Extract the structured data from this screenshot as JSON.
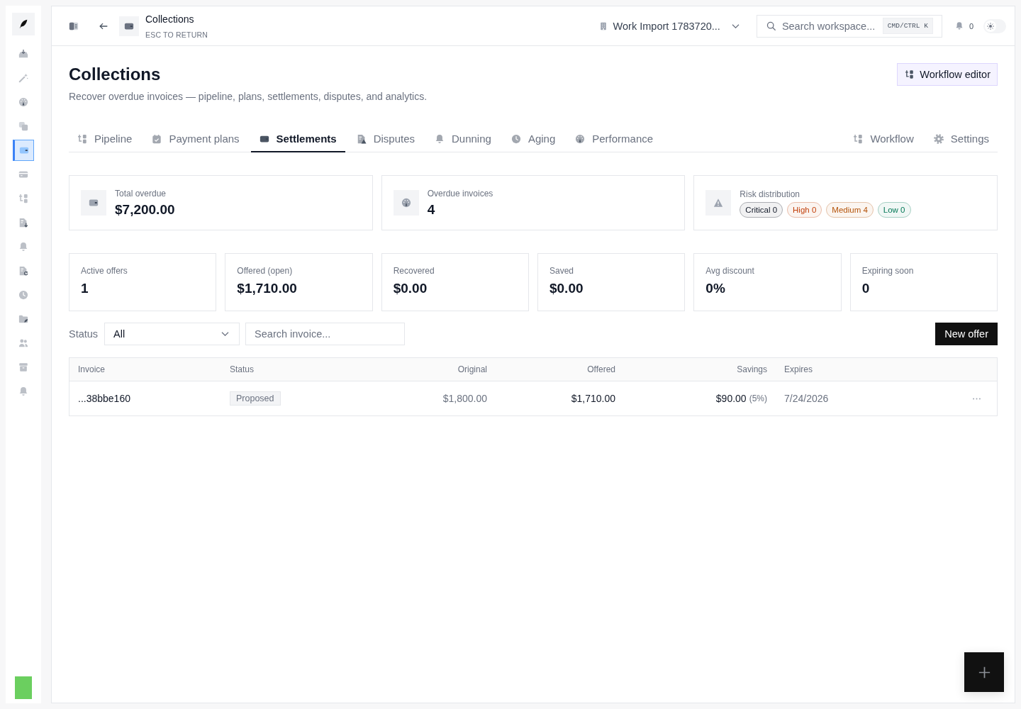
{
  "sidebar": {
    "items": [
      {
        "selected": false
      },
      {
        "selected": false
      },
      {
        "selected": false
      },
      {
        "selected": false
      },
      {
        "selected": true
      },
      {
        "selected": false
      },
      {
        "selected": false
      },
      {
        "selected": false
      },
      {
        "selected": false
      },
      {
        "selected": false
      },
      {
        "selected": false
      },
      {
        "selected": false
      },
      {
        "selected": false
      },
      {
        "selected": false
      },
      {
        "selected": false
      }
    ]
  },
  "top_bar": {
    "title": "Collections",
    "hint": "ESC TO RETURN",
    "workspace": "Work Import 1783720...",
    "search": {
      "placeholder": "Search workspace...",
      "shortcut": "CMD/CTRL K"
    },
    "notification_count": "0",
    "theme_toggle": {
      "on": false
    }
  },
  "header": {
    "title": "Collections",
    "subtitle": "Recover overdue invoices — pipeline, plans, settlements, disputes, and analytics.",
    "action": "Workflow editor"
  },
  "tabs": [
    {
      "label": "Pipeline",
      "selected": false
    },
    {
      "label": "Payment plans",
      "selected": false
    },
    {
      "label": "Settlements",
      "selected": true
    },
    {
      "label": "Disputes",
      "selected": false
    },
    {
      "label": "Dunning",
      "selected": false
    },
    {
      "label": "Aging",
      "selected": false
    },
    {
      "label": "Performance",
      "selected": false
    }
  ],
  "tab_links": [
    {
      "label": "Workflow"
    },
    {
      "label": "Settings"
    }
  ],
  "summary": [
    {
      "label": "Total overdue",
      "value": "$7,200.00"
    },
    {
      "label": "Overdue invoices",
      "value": "4"
    }
  ],
  "risk": {
    "label": "Risk distribution",
    "badges": [
      {
        "label": "Critical 0",
        "color": "#111827"
      },
      {
        "label": "High 0",
        "color": "#c2410c"
      },
      {
        "label": "Medium 4",
        "color": "#b45309"
      },
      {
        "label": "Low 0",
        "color": "#047857"
      }
    ]
  },
  "metrics": [
    {
      "label": "Active offers",
      "value": "1"
    },
    {
      "label": "Offered (open)",
      "value": "$1,710.00"
    },
    {
      "label": "Recovered",
      "value": "$0.00"
    },
    {
      "label": "Saved",
      "value": "$0.00"
    },
    {
      "label": "Avg discount",
      "value": "0%"
    },
    {
      "label": "Expiring soon",
      "value": "0"
    }
  ],
  "filters": {
    "status_label": "Status",
    "status_value": "All",
    "search_placeholder": "Search invoice...",
    "new_button": "New offer"
  },
  "table": {
    "columns": [
      "Invoice",
      "Status",
      "Original",
      "Offered",
      "Savings",
      "Expires"
    ],
    "rows": [
      {
        "invoice": "...38bbe160",
        "status": "Proposed",
        "original": "$1,800.00",
        "offered": "$1,710.00",
        "savings": "$90.00",
        "savings_share": "(5%)",
        "expires": "7/24/2026"
      }
    ]
  }
}
